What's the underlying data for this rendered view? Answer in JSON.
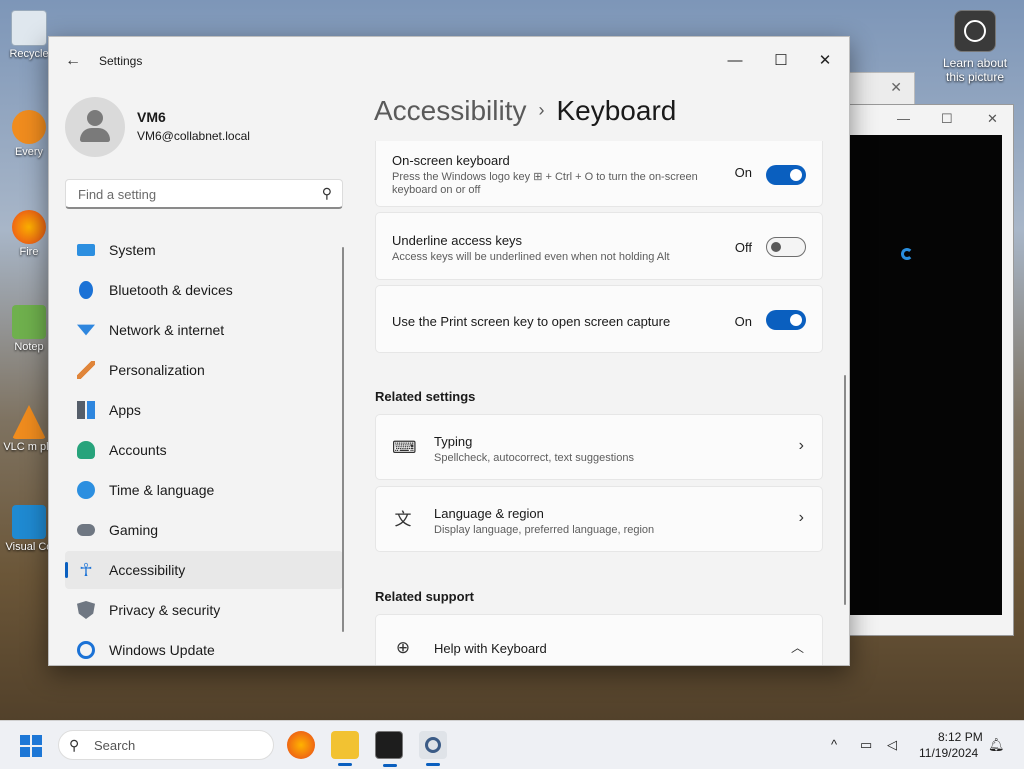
{
  "desktop": {
    "icons": [
      {
        "label": "Recycle"
      },
      {
        "label": "Every"
      },
      {
        "label": "Fire"
      },
      {
        "label": "Notep"
      },
      {
        "label": "VLC m pla"
      },
      {
        "label": "Visual Co"
      }
    ],
    "learn_label": "Learn about this picture"
  },
  "settings": {
    "title": "Settings",
    "user": {
      "name": "VM6",
      "email": "VM6@collabnet.local"
    },
    "search_placeholder": "Find a setting",
    "nav": [
      {
        "label": "System",
        "icon": "system-icon",
        "color": "#2c8fe0"
      },
      {
        "label": "Bluetooth & devices",
        "icon": "bluetooth-icon",
        "color": "#1b72d6"
      },
      {
        "label": "Network & internet",
        "icon": "wifi-icon",
        "color": "#2e86de"
      },
      {
        "label": "Personalization",
        "icon": "brush-icon",
        "color": "#e0853a"
      },
      {
        "label": "Apps",
        "icon": "apps-icon",
        "color": "#555e6a"
      },
      {
        "label": "Accounts",
        "icon": "accounts-icon",
        "color": "#27a37b"
      },
      {
        "label": "Time & language",
        "icon": "globe-clock-icon",
        "color": "#2c8fe0"
      },
      {
        "label": "Gaming",
        "icon": "gamepad-icon",
        "color": "#6f7782"
      },
      {
        "label": "Accessibility",
        "icon": "accessibility-icon",
        "color": "#1b72d6"
      },
      {
        "label": "Privacy & security",
        "icon": "shield-icon",
        "color": "#6f7782"
      },
      {
        "label": "Windows Update",
        "icon": "update-icon",
        "color": "#1b72d6"
      }
    ],
    "breadcrumb": {
      "parent": "Accessibility",
      "separator": "›",
      "current": "Keyboard"
    },
    "cards": [
      {
        "title": "On-screen keyboard",
        "desc": "Press the Windows logo key ⊞ + Ctrl + O to turn the on-screen keyboard on or off",
        "state": "On"
      },
      {
        "title": "Underline access keys",
        "desc": "Access keys will be underlined even when not holding Alt",
        "state": "Off"
      },
      {
        "title": "Use the Print screen key to open screen capture",
        "desc": "",
        "state": "On"
      }
    ],
    "related_settings_header": "Related settings",
    "related_settings": [
      {
        "title": "Typing",
        "desc": "Spellcheck, autocorrect, text suggestions",
        "icon": "keyboard-icon"
      },
      {
        "title": "Language & region",
        "desc": "Display language, preferred language, region",
        "icon": "language-icon"
      }
    ],
    "related_support_header": "Related support",
    "support": [
      {
        "title": "Help with Keyboard",
        "icon": "globe-help-icon"
      }
    ]
  },
  "taskbar": {
    "search_label": "Search",
    "time": "8:12 PM",
    "date": "11/19/2024"
  },
  "colors": {
    "accent": "#0a5fbf"
  }
}
